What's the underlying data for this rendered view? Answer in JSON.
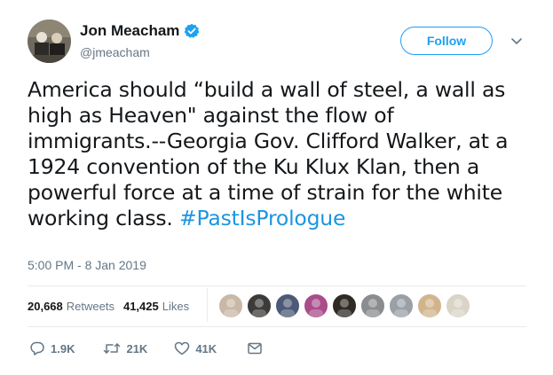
{
  "author": {
    "display_name": "Jon Meacham",
    "handle": "@jmeacham",
    "verified": true
  },
  "follow_button": {
    "label": "Follow"
  },
  "tweet": {
    "text": "America should “build a wall of steel, a wall as high as Heaven\" against the flow of immigrants.--Georgia Gov. Clifford Walker, at a 1924 convention of the Ku Klux Klan, then a powerful force at a time of strain for the white working class. ",
    "hashtag": "#PastIsPrologue",
    "timestamp": "5:00 PM - 8 Jan 2019"
  },
  "stats": {
    "retweets_count": "20,668",
    "retweets_label": "Retweets",
    "likes_count": "41,425",
    "likes_label": "Likes"
  },
  "likers": [
    {
      "name": "liker-avatar",
      "color": "#c9b8a6"
    },
    {
      "name": "liker-avatar",
      "color": "#3d3b3a"
    },
    {
      "name": "liker-avatar",
      "color": "#4b5a76"
    },
    {
      "name": "liker-avatar",
      "color": "#a94c8a"
    },
    {
      "name": "liker-avatar",
      "color": "#2f2a24"
    },
    {
      "name": "liker-avatar",
      "color": "#8a8c8e"
    },
    {
      "name": "liker-avatar",
      "color": "#9aa0a6"
    },
    {
      "name": "liker-avatar",
      "color": "#d2b48c"
    },
    {
      "name": "liker-avatar",
      "color": "#d9d4c7"
    }
  ],
  "actions": {
    "reply_count": "1.9K",
    "retweet_count": "21K",
    "like_count": "41K"
  },
  "colors": {
    "accent": "#1da1f2",
    "hashtag": "#1b95e0",
    "muted": "#657786"
  },
  "icons": [
    "verified-badge-icon",
    "chevron-down-icon",
    "reply-icon",
    "retweet-icon",
    "like-icon",
    "message-icon"
  ]
}
